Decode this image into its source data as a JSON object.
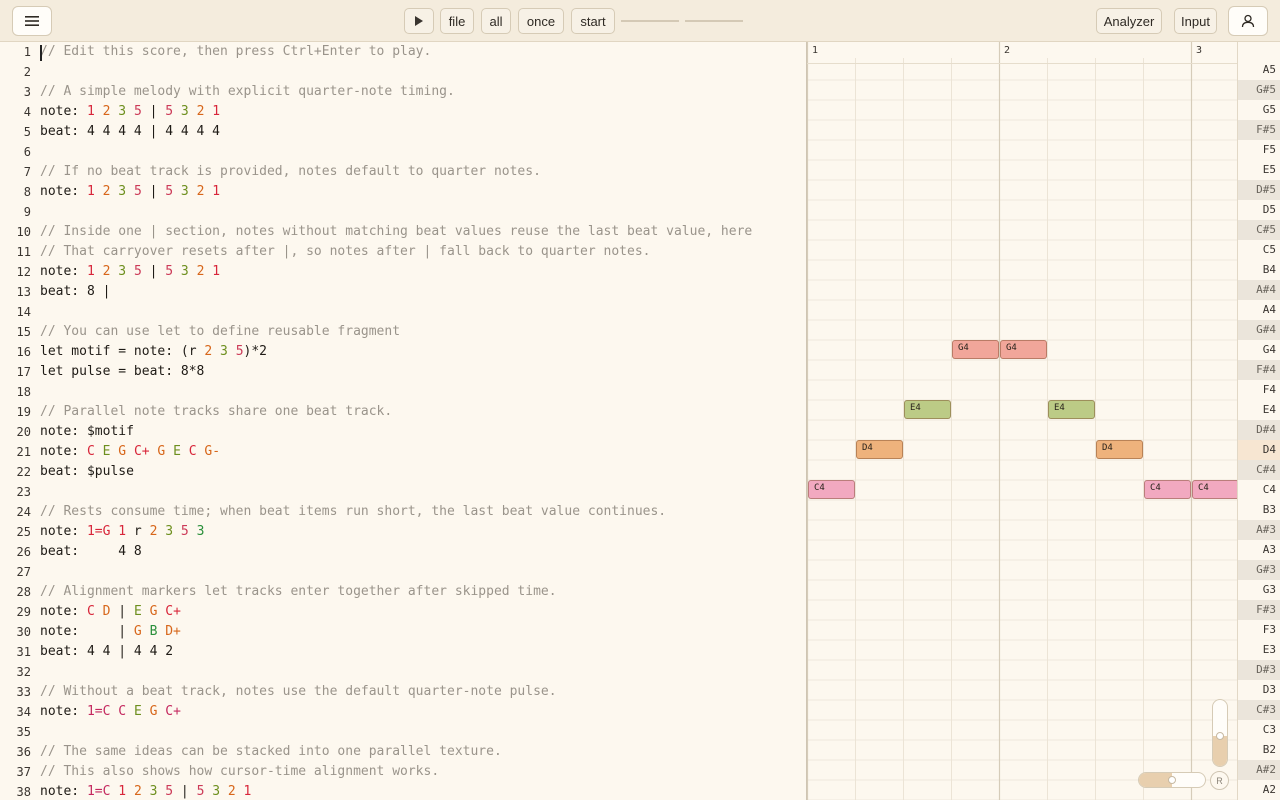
{
  "toolbar": {
    "file_label": "file",
    "all_label": "all",
    "once_label": "once",
    "start_label": "start",
    "analyzer_label": "Analyzer",
    "input_label": "Input"
  },
  "editor": {
    "lines": [
      [
        [
          "cm",
          "// Edit this score, then press Ctrl+Enter to play."
        ]
      ],
      [],
      [
        [
          "cm",
          "// A simple melody with explicit quarter-note timing."
        ]
      ],
      [
        [
          "",
          "note: "
        ],
        [
          "r",
          "1"
        ],
        [
          "",
          " "
        ],
        [
          "o",
          "2"
        ],
        [
          "",
          " "
        ],
        [
          "g",
          "3"
        ],
        [
          "",
          " "
        ],
        [
          "pk",
          "5"
        ],
        [
          "",
          " | "
        ],
        [
          "pk",
          "5"
        ],
        [
          "",
          " "
        ],
        [
          "g",
          "3"
        ],
        [
          "",
          " "
        ],
        [
          "o",
          "2"
        ],
        [
          "",
          " "
        ],
        [
          "r",
          "1"
        ]
      ],
      [
        [
          "",
          "beat: 4 4 4 4 | 4 4 4 4"
        ]
      ],
      [],
      [
        [
          "cm",
          "// If no beat track is provided, notes default to quarter notes."
        ]
      ],
      [
        [
          "",
          "note: "
        ],
        [
          "r",
          "1"
        ],
        [
          "",
          " "
        ],
        [
          "o",
          "2"
        ],
        [
          "",
          " "
        ],
        [
          "g",
          "3"
        ],
        [
          "",
          " "
        ],
        [
          "pk",
          "5"
        ],
        [
          "",
          " | "
        ],
        [
          "pk",
          "5"
        ],
        [
          "",
          " "
        ],
        [
          "g",
          "3"
        ],
        [
          "",
          " "
        ],
        [
          "o",
          "2"
        ],
        [
          "",
          " "
        ],
        [
          "r",
          "1"
        ]
      ],
      [],
      [
        [
          "cm",
          "// Inside one | section, notes without matching beat values reuse the last beat value, here"
        ]
      ],
      [
        [
          "cm",
          "// That carryover resets after |, so notes after | fall back to quarter notes."
        ]
      ],
      [
        [
          "",
          "note: "
        ],
        [
          "r",
          "1"
        ],
        [
          "",
          " "
        ],
        [
          "o",
          "2"
        ],
        [
          "",
          " "
        ],
        [
          "g",
          "3"
        ],
        [
          "",
          " "
        ],
        [
          "pk",
          "5"
        ],
        [
          "",
          " | "
        ],
        [
          "pk",
          "5"
        ],
        [
          "",
          " "
        ],
        [
          "g",
          "3"
        ],
        [
          "",
          " "
        ],
        [
          "o",
          "2"
        ],
        [
          "",
          " "
        ],
        [
          "r",
          "1"
        ]
      ],
      [
        [
          "",
          "beat: 8 |"
        ]
      ],
      [],
      [
        [
          "cm",
          "// You can use let to define reusable fragment"
        ]
      ],
      [
        [
          "",
          "let motif = note: (r "
        ],
        [
          "o",
          "2"
        ],
        [
          "",
          " "
        ],
        [
          "g",
          "3"
        ],
        [
          "",
          " "
        ],
        [
          "pk",
          "5"
        ],
        [
          "",
          ")*2"
        ]
      ],
      [
        [
          "",
          "let pulse = beat: 8*8"
        ]
      ],
      [],
      [
        [
          "cm",
          "// Parallel note tracks share one beat track."
        ]
      ],
      [
        [
          "",
          "note: $motif"
        ]
      ],
      [
        [
          "",
          "note: "
        ],
        [
          "r",
          "C"
        ],
        [
          "",
          " "
        ],
        [
          "g",
          "E"
        ],
        [
          "",
          " "
        ],
        [
          "o",
          "G"
        ],
        [
          "",
          " "
        ],
        [
          "r",
          "C+"
        ],
        [
          "",
          " "
        ],
        [
          "o",
          "G"
        ],
        [
          "",
          " "
        ],
        [
          "g",
          "E"
        ],
        [
          "",
          " "
        ],
        [
          "r",
          "C"
        ],
        [
          "",
          " "
        ],
        [
          "o",
          "G-"
        ]
      ],
      [
        [
          "",
          "beat: $pulse"
        ]
      ],
      [],
      [
        [
          "cm",
          "// Rests consume time; when beat items run short, the last beat value continues."
        ]
      ],
      [
        [
          "",
          "note: "
        ],
        [
          "r",
          "1=G"
        ],
        [
          "",
          " "
        ],
        [
          "r",
          "1"
        ],
        [
          "",
          " r "
        ],
        [
          "o",
          "2"
        ],
        [
          "",
          " "
        ],
        [
          "g",
          "3"
        ],
        [
          "",
          " "
        ],
        [
          "pk",
          "5"
        ],
        [
          "",
          " "
        ],
        [
          "gd",
          "3"
        ]
      ],
      [
        [
          "",
          "beat:     4 8"
        ]
      ],
      [],
      [
        [
          "cm",
          "// Alignment markers let tracks enter together after skipped time."
        ]
      ],
      [
        [
          "",
          "note: "
        ],
        [
          "r",
          "C"
        ],
        [
          "",
          " "
        ],
        [
          "o",
          "D"
        ],
        [
          "",
          " | "
        ],
        [
          "g",
          "E"
        ],
        [
          "",
          " "
        ],
        [
          "o",
          "G"
        ],
        [
          "",
          " "
        ],
        [
          "r",
          "C+"
        ]
      ],
      [
        [
          "",
          "note:     | "
        ],
        [
          "o",
          "G"
        ],
        [
          "",
          " "
        ],
        [
          "gd",
          "B"
        ],
        [
          "",
          " "
        ],
        [
          "o",
          "D+"
        ]
      ],
      [
        [
          "",
          "beat: 4 4 | 4 4 2"
        ]
      ],
      [],
      [
        [
          "cm",
          "// Without a beat track, notes use the default quarter-note pulse."
        ]
      ],
      [
        [
          "",
          "note: "
        ],
        [
          "m",
          "1=C"
        ],
        [
          "",
          " "
        ],
        [
          "m",
          "C"
        ],
        [
          "",
          " "
        ],
        [
          "g",
          "E"
        ],
        [
          "",
          " "
        ],
        [
          "o",
          "G"
        ],
        [
          "",
          " "
        ],
        [
          "m",
          "C+"
        ]
      ],
      [],
      [
        [
          "cm",
          "// The same ideas can be stacked into one parallel texture."
        ]
      ],
      [
        [
          "cm",
          "// This also shows how cursor-time alignment works."
        ]
      ],
      [
        [
          "",
          "note: "
        ],
        [
          "m",
          "1=C"
        ],
        [
          "",
          " "
        ],
        [
          "r",
          "1"
        ],
        [
          "",
          " "
        ],
        [
          "o",
          "2"
        ],
        [
          "",
          " "
        ],
        [
          "g",
          "3"
        ],
        [
          "",
          " "
        ],
        [
          "pk",
          "5"
        ],
        [
          "",
          " | "
        ],
        [
          "pk",
          "5"
        ],
        [
          "",
          " "
        ],
        [
          "g",
          "3"
        ],
        [
          "",
          " "
        ],
        [
          "o",
          "2"
        ],
        [
          "",
          " "
        ],
        [
          "r",
          "1"
        ]
      ]
    ]
  },
  "piano_roll": {
    "bar_labels": [
      "1",
      "2",
      "3"
    ],
    "pitches": [
      "A5",
      "G#5",
      "G5",
      "F#5",
      "F5",
      "E5",
      "D#5",
      "D5",
      "C#5",
      "C5",
      "B4",
      "A#4",
      "A4",
      "G#4",
      "G4",
      "F#4",
      "F4",
      "E4",
      "D#4",
      "D4",
      "C#4",
      "C4",
      "B3",
      "A#3",
      "A3",
      "G#3",
      "G3",
      "F#3",
      "F3",
      "E3",
      "D#3",
      "D3",
      "C#3",
      "C3",
      "B2",
      "A#2",
      "A2"
    ],
    "active_pitch": "D4",
    "notes": [
      {
        "pitch": "C4",
        "label": "C4",
        "start": 0,
        "length": 1,
        "color": "#f2a9c0"
      },
      {
        "pitch": "D4",
        "label": "D4",
        "start": 1,
        "length": 1,
        "color": "#eeb27c"
      },
      {
        "pitch": "E4",
        "label": "E4",
        "start": 2,
        "length": 1,
        "color": "#bccb86"
      },
      {
        "pitch": "G4",
        "label": "G4",
        "start": 3,
        "length": 1,
        "color": "#f1a69a"
      },
      {
        "pitch": "G4",
        "label": "G4",
        "start": 4,
        "length": 1,
        "color": "#f1a69a"
      },
      {
        "pitch": "E4",
        "label": "E4",
        "start": 5,
        "length": 1,
        "color": "#bccb86"
      },
      {
        "pitch": "D4",
        "label": "D4",
        "start": 6,
        "length": 1,
        "color": "#eeb27c"
      },
      {
        "pitch": "C4",
        "label": "C4",
        "start": 7,
        "length": 1,
        "color": "#f2a9c0"
      },
      {
        "pitch": "C4",
        "label": "C4",
        "start": 8,
        "length": 1,
        "color": "#f2a9c0"
      }
    ],
    "reset_label": "R",
    "volume": 0.45,
    "tempo": 0.5
  }
}
